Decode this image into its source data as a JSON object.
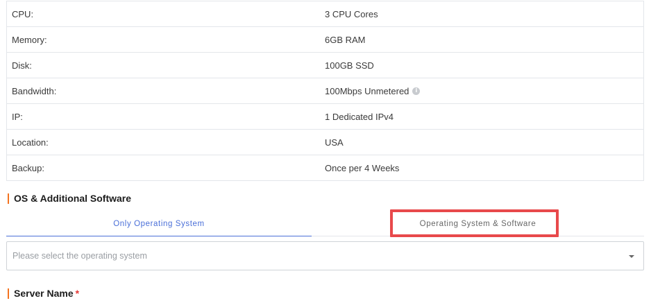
{
  "specs": [
    {
      "label": "CPU:",
      "value": "3 CPU Cores",
      "info": false
    },
    {
      "label": "Memory:",
      "value": "6GB RAM",
      "info": false
    },
    {
      "label": "Disk:",
      "value": "100GB SSD",
      "info": false
    },
    {
      "label": "Bandwidth:",
      "value": "100Mbps Unmetered",
      "info": true
    },
    {
      "label": "IP:",
      "value": "1 Dedicated IPv4",
      "info": false
    },
    {
      "label": "Location:",
      "value": "USA",
      "info": false
    },
    {
      "label": "Backup:",
      "value": "Once per 4 Weeks",
      "info": false
    }
  ],
  "os_section": {
    "title": "OS & Additional Software",
    "tabs": [
      {
        "label": "Only Operating System",
        "active": true
      },
      {
        "label": "Operating System & Software",
        "active": false
      }
    ],
    "select_placeholder": "Please select the operating system"
  },
  "server_name": {
    "title": "Server Name",
    "required_marker": "*"
  },
  "colors": {
    "accent_bar": "#f4731f",
    "active_tab": "#4a6fd8",
    "highlight_box": "#e8494b",
    "required": "#e53935"
  },
  "icons": {
    "bandwidth_info": "info-icon",
    "select_caret": "chevron-down-icon"
  }
}
